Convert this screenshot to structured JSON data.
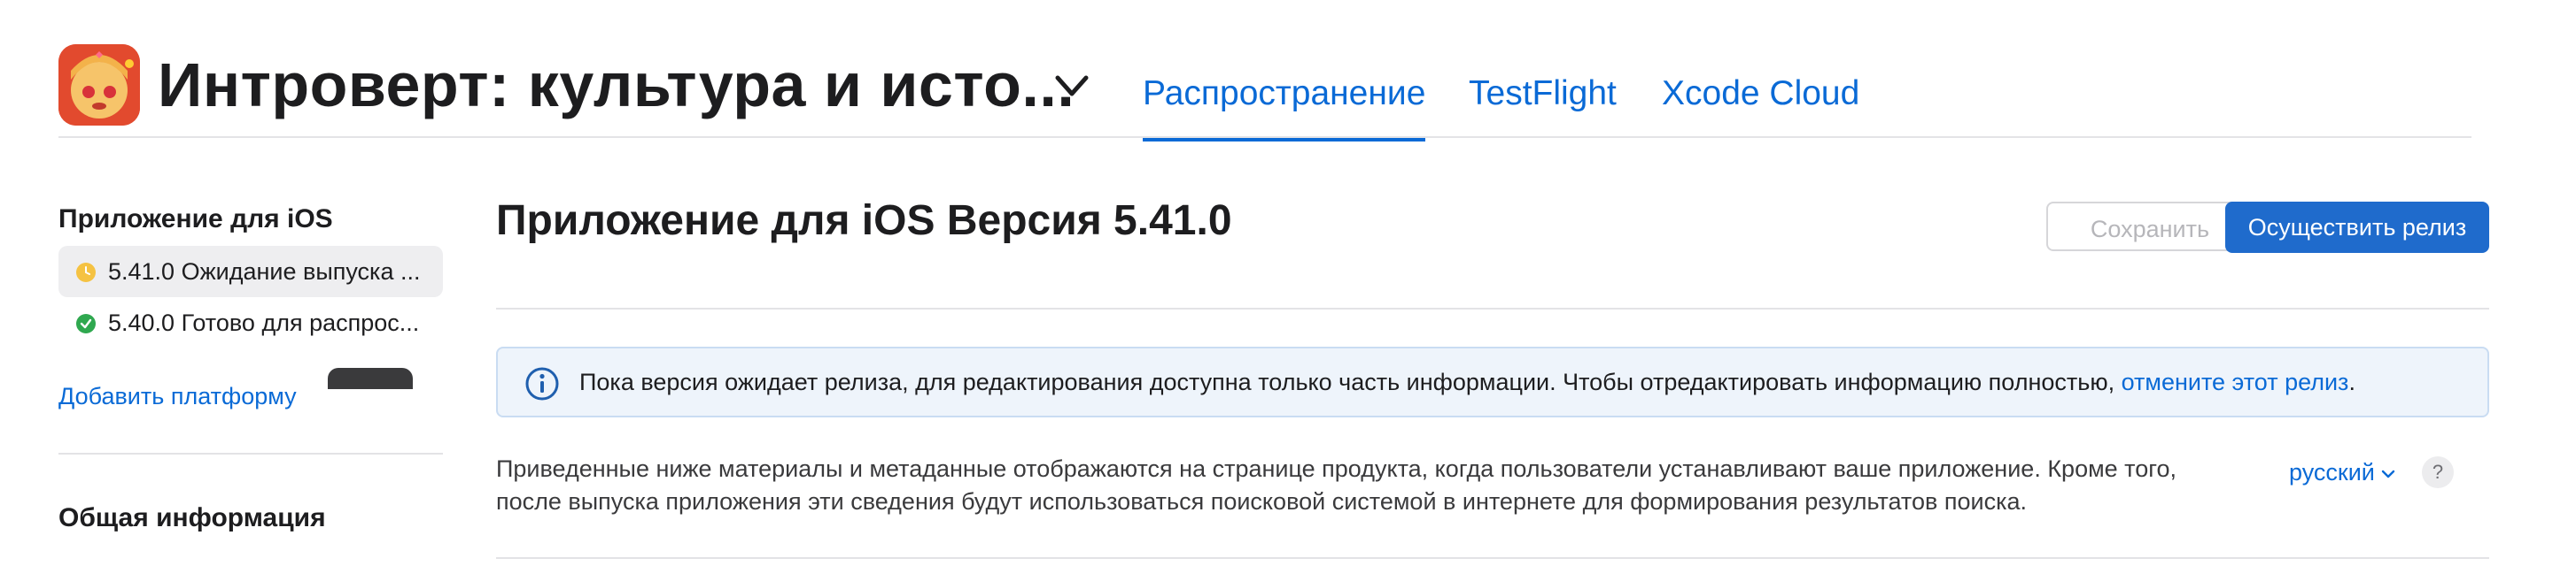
{
  "header": {
    "app_title": "Интроверт: культура и исто...",
    "tabs": [
      {
        "label": "Распространение",
        "active": true
      },
      {
        "label": "TestFlight",
        "active": false
      },
      {
        "label": "Xcode Cloud",
        "active": false
      }
    ],
    "app_icon": "app-icon",
    "title_dropdown_icon": "chevron-down-icon"
  },
  "sidebar": {
    "platform_heading": "Приложение для iOS",
    "versions": [
      {
        "label": "5.41.0 Ожидание выпуска ...",
        "status": "pending",
        "status_color": "#f5c242",
        "selected": true
      },
      {
        "label": "5.40.0 Готово для распрос...",
        "status": "ready",
        "status_color": "#2fa84f",
        "selected": false
      }
    ],
    "add_platform": "Добавить платформу",
    "general_heading": "Общая информация"
  },
  "main": {
    "title": "Приложение для iOS Версия 5.41.0",
    "save_label": "Сохранить",
    "release_label": "Осуществить релиз",
    "notice": {
      "text": "Пока версия ожидает релиза, для редактирования доступна только часть информации. Чтобы отредактировать информацию полностью,",
      "link": "отмените этот релиз",
      "suffix": ".",
      "icon": "info-icon"
    },
    "description_line1": "Приведенные ниже материалы и метаданные отображаются на странице продукта, когда пользователи устанавливают ваше приложение. Кроме того,",
    "description_line2": "после выпуска приложения эти сведения будут использоваться поисковой системой в интернете для формирования результатов поиска.",
    "language": "русский",
    "help": "?"
  },
  "colors": {
    "accent": "#0a6ad6",
    "primary_button": "#1f6bcc",
    "notice_bg": "#eef4fb"
  }
}
